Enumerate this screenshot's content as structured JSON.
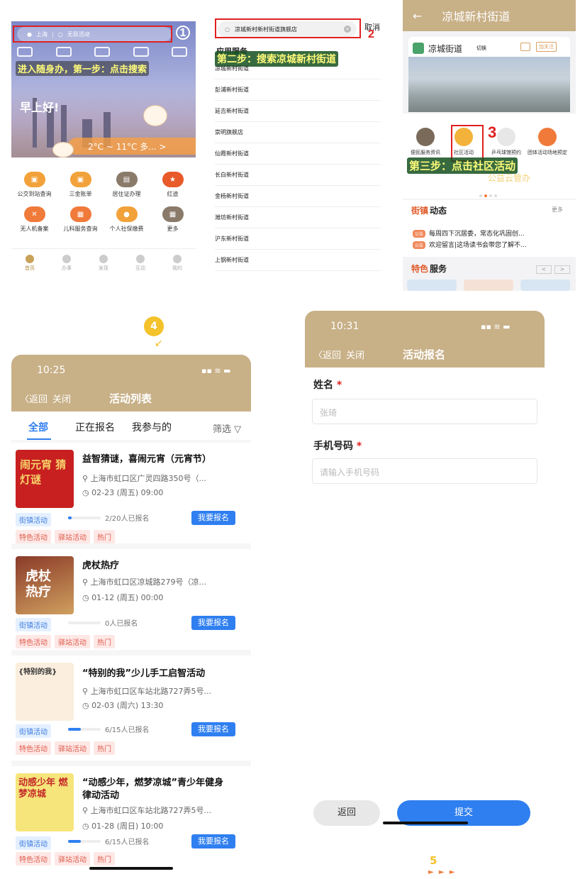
{
  "panel1": {
    "location": "上海",
    "search_placeholder": "无目活动",
    "step_num": "1",
    "caption": "进入随身办，第一步：点击搜索",
    "greeting": "早上好!",
    "weather": "2°C ~ 11°C  多...   >",
    "services": [
      "公交到站查询",
      "三金账单",
      "居住证办理",
      "红途",
      "无人机备案",
      "儿科服务查询",
      "个人社保缴费",
      "更多"
    ],
    "tabs": [
      "首页",
      "办事",
      "发现",
      "互动",
      "我的"
    ]
  },
  "panel2": {
    "search_value": "凉城新村新村街道旗舰店",
    "cancel": "取消",
    "step_num": "2",
    "section": "应用服务",
    "caption": "第二步：搜索凉城新村街道",
    "results": [
      "凉城新村街道",
      "彭浦新村街道",
      "延吉新村街道",
      "崇明旗舰店",
      "仙霞新村街道",
      "长白新村街道",
      "金杨新村街道",
      "潍坊新村街道",
      "沪东新村街道",
      "上钢新村街道"
    ]
  },
  "panel3": {
    "title": "凉城新村街道",
    "card_name": "凉城街道",
    "switch": "切换",
    "follow": "加关注",
    "step_num": "3",
    "icons": [
      "便民服务资讯",
      "社区活动",
      "乒乓球馆预约",
      "团体活动场地预定"
    ],
    "caption": "第三步：点击社区活动",
    "banner_text": "公益云管办",
    "news_title_a": "街镇",
    "news_title_b": "动态",
    "more": "更多",
    "notice_badge": "公告",
    "notices": [
      "每周四下沉居委，常态化巩固创...",
      "欢迎留言|这场读书会带您了解不..."
    ],
    "feature_a": "特色",
    "feature_b": "服务"
  },
  "step4": "4",
  "panel4": {
    "time": "10:25",
    "back": "返回",
    "close": "关闭",
    "title": "活动列表",
    "tabs": [
      "全部",
      "正在报名",
      "我参与的"
    ],
    "filter": "筛选",
    "signup": "我要报名",
    "items": [
      {
        "title": "益智猜谜，喜闹元宵（元宵节）",
        "title2": "",
        "addr": "上海市虹口区广灵四路350号（...",
        "time": "02-23 (周五) 09:00",
        "count": "2/20人已报名",
        "progress": 0.1,
        "tags": [
          "街镇活动"
        ],
        "tags2": [
          "特色活动",
          "驿站活动",
          "热门"
        ],
        "thumb_text": "闹元宵 猜灯谜"
      },
      {
        "title": "虎杖热疗",
        "title2": "",
        "addr": "上海市虹口区凉城路279号（凉...",
        "time": "01-12 (周五) 00:00",
        "count": "0人已报名",
        "progress": 0,
        "tags": [
          "街镇活动"
        ],
        "tags2": [
          "特色活动",
          "驿站活动",
          "热门"
        ],
        "thumb_text": "虎杖 热疗"
      },
      {
        "title": "“特别的我”少儿手工启智活动",
        "title2": "",
        "addr": "上海市虹口区车站北路727弄5号...",
        "time": "02-03 (周六) 13:30",
        "count": "6/15人已报名",
        "progress": 0.4,
        "tags": [
          "街镇活动"
        ],
        "tags2": [
          "特色活动",
          "驿站活动",
          "热门"
        ],
        "thumb_text": "{特别的我}"
      },
      {
        "title": "“动感少年，燃梦凉城”青少年健身",
        "title2": "律动活动",
        "addr": "上海市虹口区车站北路727弄5号...",
        "time": "01-28 (周日) 10:00",
        "count": "6/15人已报名",
        "progress": 0.4,
        "tags": [
          "街镇活动"
        ],
        "tags2": [
          "特色活动",
          "驿站活动",
          "热门"
        ],
        "thumb_text": "动感少年 燃梦凉城"
      }
    ]
  },
  "panel5": {
    "time": "10:31",
    "back": "返回",
    "close": "关闭",
    "title": "活动报名",
    "name_label": "姓名",
    "name_value": "张琦",
    "phone_label": "手机号码",
    "phone_placeholder": "请输入手机号码",
    "btn_back": "返回",
    "btn_submit": "提交"
  },
  "step5": "5",
  "step5_arrows": "► ► ►",
  "colors": {
    "header": "#c8b087",
    "accent": "#2f7ff0",
    "step_red": "#e02020"
  }
}
